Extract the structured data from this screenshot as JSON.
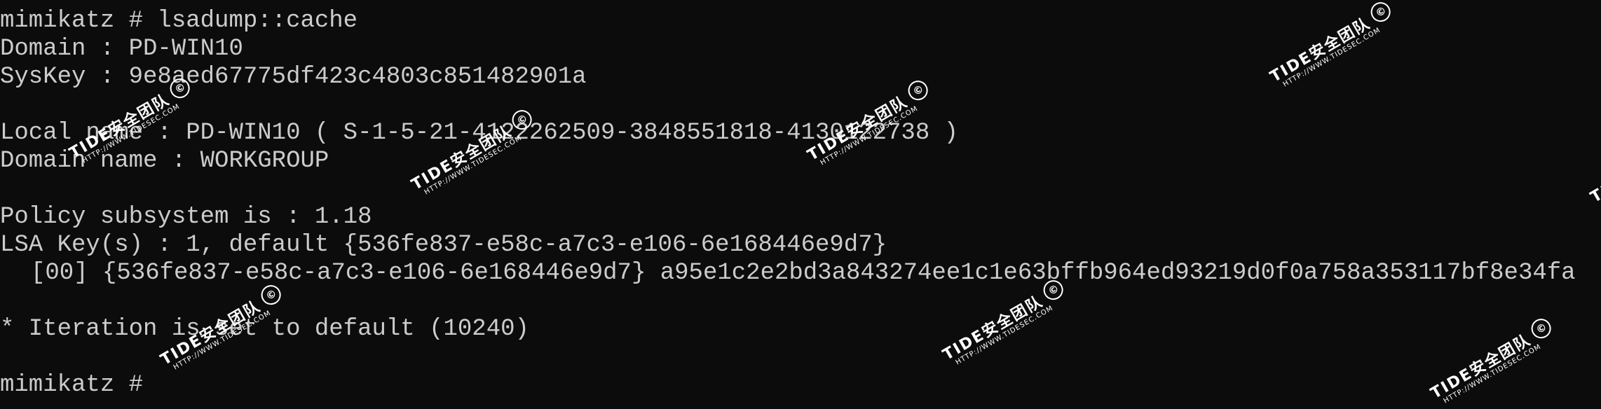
{
  "terminal": {
    "lines": [
      "mimikatz # lsadump::cache",
      "Domain : PD-WIN10",
      "SysKey : 9e8aed67775df423c4803c851482901a",
      "",
      "Local name : PD-WIN10 ( S-1-5-21-4122262509-3848551818-4130122738 )",
      "Domain name : WORKGROUP",
      "",
      "Policy subsystem is : 1.18",
      "LSA Key(s) : 1, default {536fe837-e58c-a7c3-e106-6e168446e9d7}",
      "[00] {536fe837-e58c-a7c3-e106-6e168446e9d7} a95e1c2e2bd3a843274ee1c1e63bffb964ed93219d0f0a758a353117bf8e34fa",
      "",
      "* Iteration is set to default (10240)",
      "",
      "mimikatz # "
    ]
  },
  "watermark": {
    "brand": "TIDE安全团队",
    "copyright_symbol": "©",
    "url": "HTTP://WWW.TIDESEC.COM"
  },
  "colors": {
    "background": "#0c0c0c",
    "text": "#cccccc",
    "watermark": "#ffffff"
  }
}
